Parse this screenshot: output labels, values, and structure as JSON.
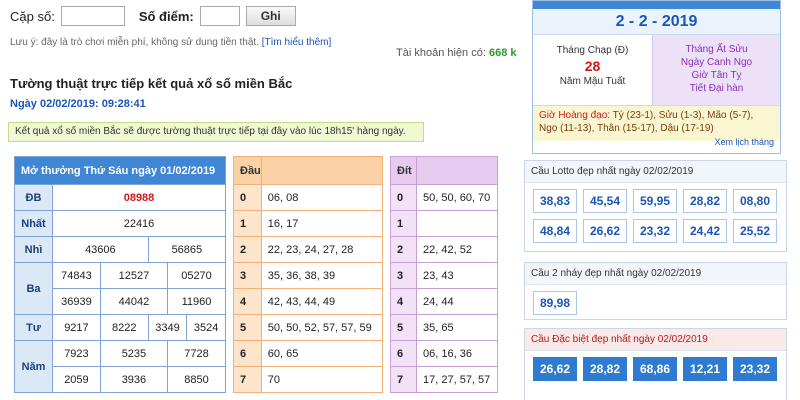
{
  "form": {
    "cap_so_label": "Cặp số:",
    "so_diem_label": "Số điểm:",
    "ghi_label": "Ghi",
    "note": "Lưu ý: đây là trò chơi miễn phí, không sử dụng tiền thật.",
    "note_link": "[Tìm hiểu thêm]",
    "balance_label": "Tài khoản hiện có:",
    "balance_value": "668 k"
  },
  "heading": {
    "title": "Tường thuật trực tiếp kết quả xổ số miền Bắc",
    "date": "Ngày 02/02/2019: 09:28:41",
    "info": "Kết quả xổ số miền Bắc sẽ được tường thuật trực tiếp tại đây vào lúc 18h15' hàng ngày."
  },
  "results": {
    "header": "Mở thưởng Thứ Sáu ngày 01/02/2019",
    "db_label": "ĐB",
    "db": "08988",
    "nhat_label": "Nhất",
    "nhat": "22416",
    "nhi_label": "Nhì",
    "nhi": [
      "43606",
      "56865"
    ],
    "ba_label": "Ba",
    "ba": [
      "74843",
      "12527",
      "05270",
      "36939",
      "44042",
      "11960"
    ],
    "tu_label": "Tư",
    "tu": [
      "9217",
      "8222",
      "3349",
      "3524"
    ],
    "nam_label": "Năm",
    "nam": [
      "7923",
      "5235",
      "7728",
      "2059",
      "3936",
      "8850"
    ]
  },
  "dau": {
    "header": "Đầu",
    "keys": [
      "0",
      "1",
      "2",
      "3",
      "4",
      "5",
      "6",
      "7"
    ],
    "values": [
      "06, 08",
      "16, 17",
      "22, 23, 24, 27, 28",
      "35, 36, 38, 39",
      "42, 43, 44, 49",
      "50, 50, 52, 57, 57, 59",
      "60, 65",
      "70"
    ]
  },
  "dit": {
    "header": "Đít",
    "keys": [
      "0",
      "1",
      "2",
      "3",
      "4",
      "5",
      "6",
      "7"
    ],
    "values": [
      "50, 50, 60, 70",
      "",
      "22, 42, 52",
      "23, 43",
      "24, 44",
      "35, 65",
      "06, 16, 36",
      "17, 27, 57, 57"
    ]
  },
  "calendar": {
    "date": "2 - 2 - 2019",
    "solar_month": "Tháng Chạp (Đ)",
    "solar_day": "28",
    "solar_year": "Năm Mậu Tuất",
    "lunar": [
      "Tháng Ất Sửu",
      "Ngày Canh Ngọ",
      "Giờ Tân Tỵ",
      "Tiết Đại hàn"
    ],
    "hours_label": "Giờ Hoàng đạo:",
    "hours": "Tý (23-1), Sửu (1-3), Mão (5-7), Ngọ (11-13), Thân (15-17), Dậu (17-19)",
    "more": "Xem lịch tháng"
  },
  "panels": {
    "lotto_title": "Cầu Lotto đẹp nhất ngày 02/02/2019",
    "lotto": [
      "38,83",
      "45,54",
      "59,95",
      "28,82",
      "08,80",
      "48,84",
      "26,62",
      "23,32",
      "24,42",
      "25,52"
    ],
    "nhay_title": "Cầu 2 nháy đẹp nhất ngày 02/02/2019",
    "nhay": [
      "89,98"
    ],
    "db_title": "Cầu Đặc biệt đẹp nhất ngày 02/02/2019",
    "db": [
      "26,62",
      "28,82",
      "68,86",
      "12,21",
      "23,32"
    ]
  },
  "colors": {
    "accent": "#3f86d4",
    "red": "#d21a1a",
    "green": "#2a9a2a"
  }
}
